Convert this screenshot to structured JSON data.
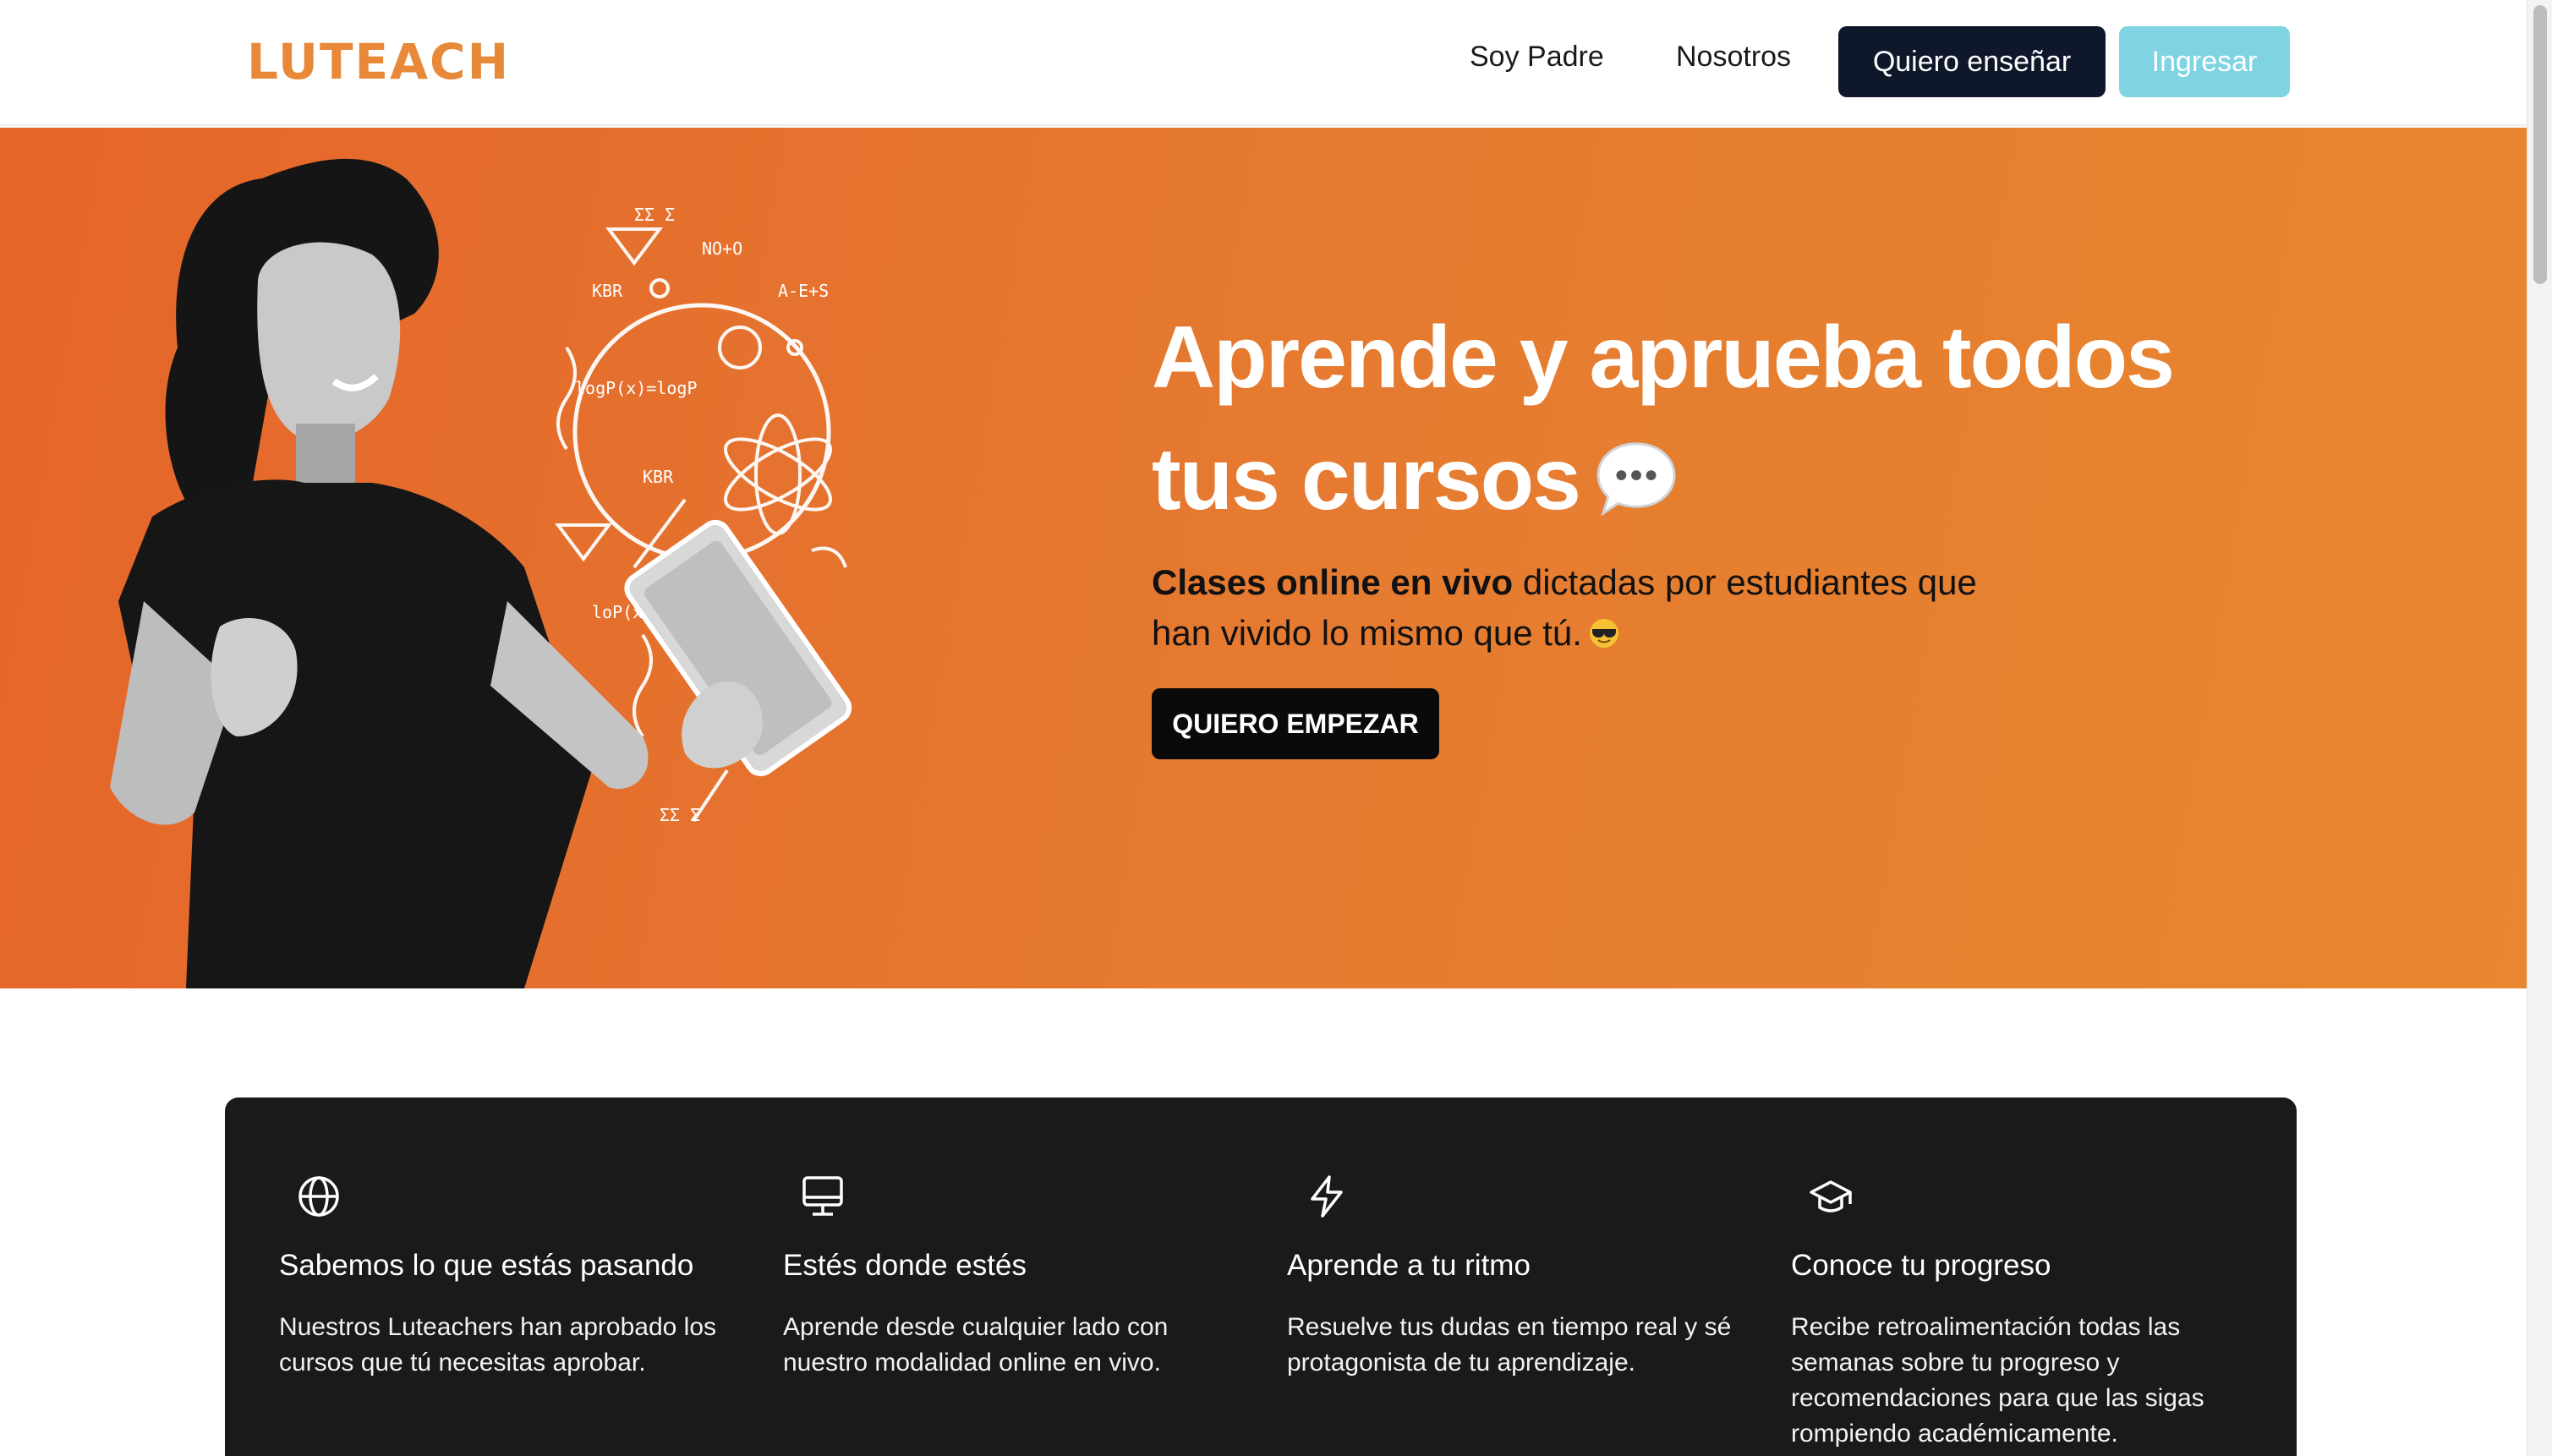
{
  "brand": {
    "logo": "LUTEACH",
    "accent": "#e8893a"
  },
  "nav": {
    "padre": "Soy Padre",
    "nosotros": "Nosotros",
    "ensenar": "Quiero enseñar",
    "ingresar": "Ingresar"
  },
  "hero": {
    "title": "Aprende y aprueba todos tus cursos",
    "title_icon": "speech-bubble-icon",
    "subtitle_bold": "Clases online en vivo",
    "subtitle_rest": " dictadas por estudiantes que han vivido lo mismo que tú.",
    "subtitle_icon": "sunglasses-emoji-icon",
    "cta": "QUIERO EMPEZAR",
    "colors": {
      "gradient_start": "#e5652a",
      "gradient_end": "#e8872f"
    }
  },
  "features": [
    {
      "icon": "globe-icon",
      "title": "Sabemos lo que estás pasando",
      "desc": "Nuestros Luteachers han aprobado los cursos que tú necesitas aprobar."
    },
    {
      "icon": "monitor-icon",
      "title": "Estés donde estés",
      "desc": "Aprende desde cualquier lado con nuestro modalidad online en vivo."
    },
    {
      "icon": "lightning-icon",
      "title": "Aprende a tu ritmo",
      "desc": "Resuelve tus dudas en tiempo real y sé protagonista de tu aprendizaje."
    },
    {
      "icon": "graduation-cap-icon",
      "title": "Conoce tu progreso",
      "desc": "Recibe retroalimentación todas las semanas sobre tu progreso y recomendaciones para que las sigas rompiendo académicamente."
    }
  ]
}
